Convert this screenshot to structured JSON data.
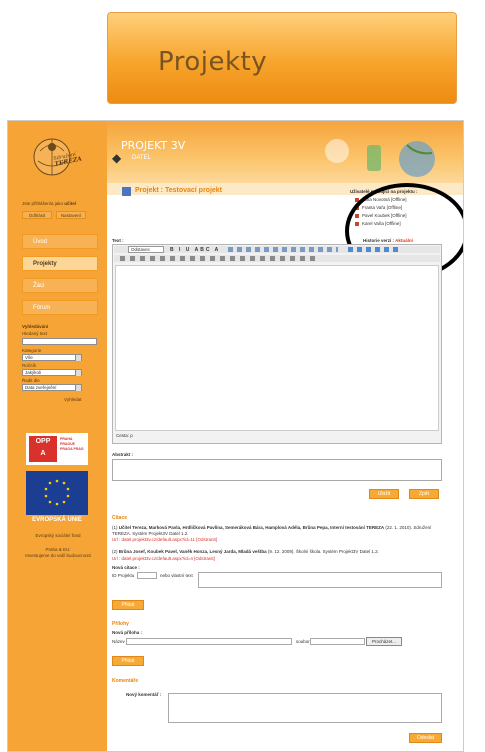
{
  "banner": {
    "label": "Projekty"
  },
  "header": {
    "title": "PROJEKT 3V",
    "subtitle": "DATEL"
  },
  "logo": {
    "text1": "Sdružení",
    "text2": "TEREZA"
  },
  "login": {
    "status": "Jste přihlášen/a jako",
    "role": "učitel",
    "logout": "Odhlásit",
    "settings": "Nastavení"
  },
  "nav": [
    {
      "label": "Úvod"
    },
    {
      "label": "Projekty"
    },
    {
      "label": "Žáci"
    },
    {
      "label": "Fórum"
    }
  ],
  "search": {
    "heading": "Vyhledávání",
    "text_label": "Hledaný text",
    "category_label": "Kategorie",
    "category_value": "Vše",
    "year_label": "Ročník",
    "year_value": "Jakýkoli",
    "sort_label": "Řadit dle",
    "sort_value": "Data zveřejnění",
    "button": "Vyhledat"
  },
  "sponsors": {
    "opp": "OPP",
    "opp_letters": "A",
    "praha": "PRAHA PRAGUE PRAGA PRAG",
    "eu": "EVROPSKÁ UNIE",
    "fund": "Evropský sociální fond",
    "line2": "Praha & EU:",
    "line3": "Investujeme do vaší budoucnosti"
  },
  "project": {
    "title": "Projekt : Testovací projekt"
  },
  "users": {
    "heading": "Uživatelé pracující na projektu :",
    "list": [
      "Jana Novotná [Offline]",
      "Franta Vařa [Offline]",
      "Pavel Koubek [Offline]",
      "Karel Vaňa [Offline]"
    ]
  },
  "editor": {
    "text_label": "Text :",
    "history_label": "Historie verzí :",
    "history_value": "Aktuální",
    "format": "Odstavec",
    "path": "Cesta: p"
  },
  "abstract": {
    "label": "Abstrakt :"
  },
  "actions": {
    "save": "Uložit",
    "back": "Zpět"
  },
  "citations": {
    "heading": "Citace",
    "items": [
      {
        "num": "(1)",
        "authors": "Učitel Tereza, Marková Pavla, Hrdličková Pavlína, Semeráková Bára, Hamplová Adéla, Brůna Pepa, Interní testování TEREZA",
        "rest": "(22. 1. 2010). Sdružení TEREZA. Systém Projekt3V Datel 1.2.",
        "url": "Url : datel.projekt3v.cz/default.aspx?id=11",
        "remove": "[Odstranit]"
      },
      {
        "num": "(2)",
        "authors": "Brůna Josef, Koubek Pavel, Vaněk Honza, Lesný Jarda, Mladá veštba",
        "rest": "(9. 12. 2009). Školní škola. Systém Projekt3V Datel 1.2.",
        "url": "Url : datel.projekt3v.cz/default.aspx?id=4",
        "remove": "[Odstranit]"
      }
    ],
    "new_label": "Nová citace :",
    "id_label": "ID Projektu",
    "or_label": "nebo vlastní text",
    "add": "Přidat"
  },
  "attachments": {
    "heading": "Přílohy",
    "new_label": "Nová příloha :",
    "name_label": "Název",
    "file_label": "soubor",
    "browse": "Procházet...",
    "add": "Přidat"
  },
  "comments": {
    "heading": "Komentáře",
    "new_label": "Nový komentář :",
    "send": "Odeslat"
  },
  "colors": {
    "orange": "#f5a435",
    "accent": "#e98411"
  }
}
